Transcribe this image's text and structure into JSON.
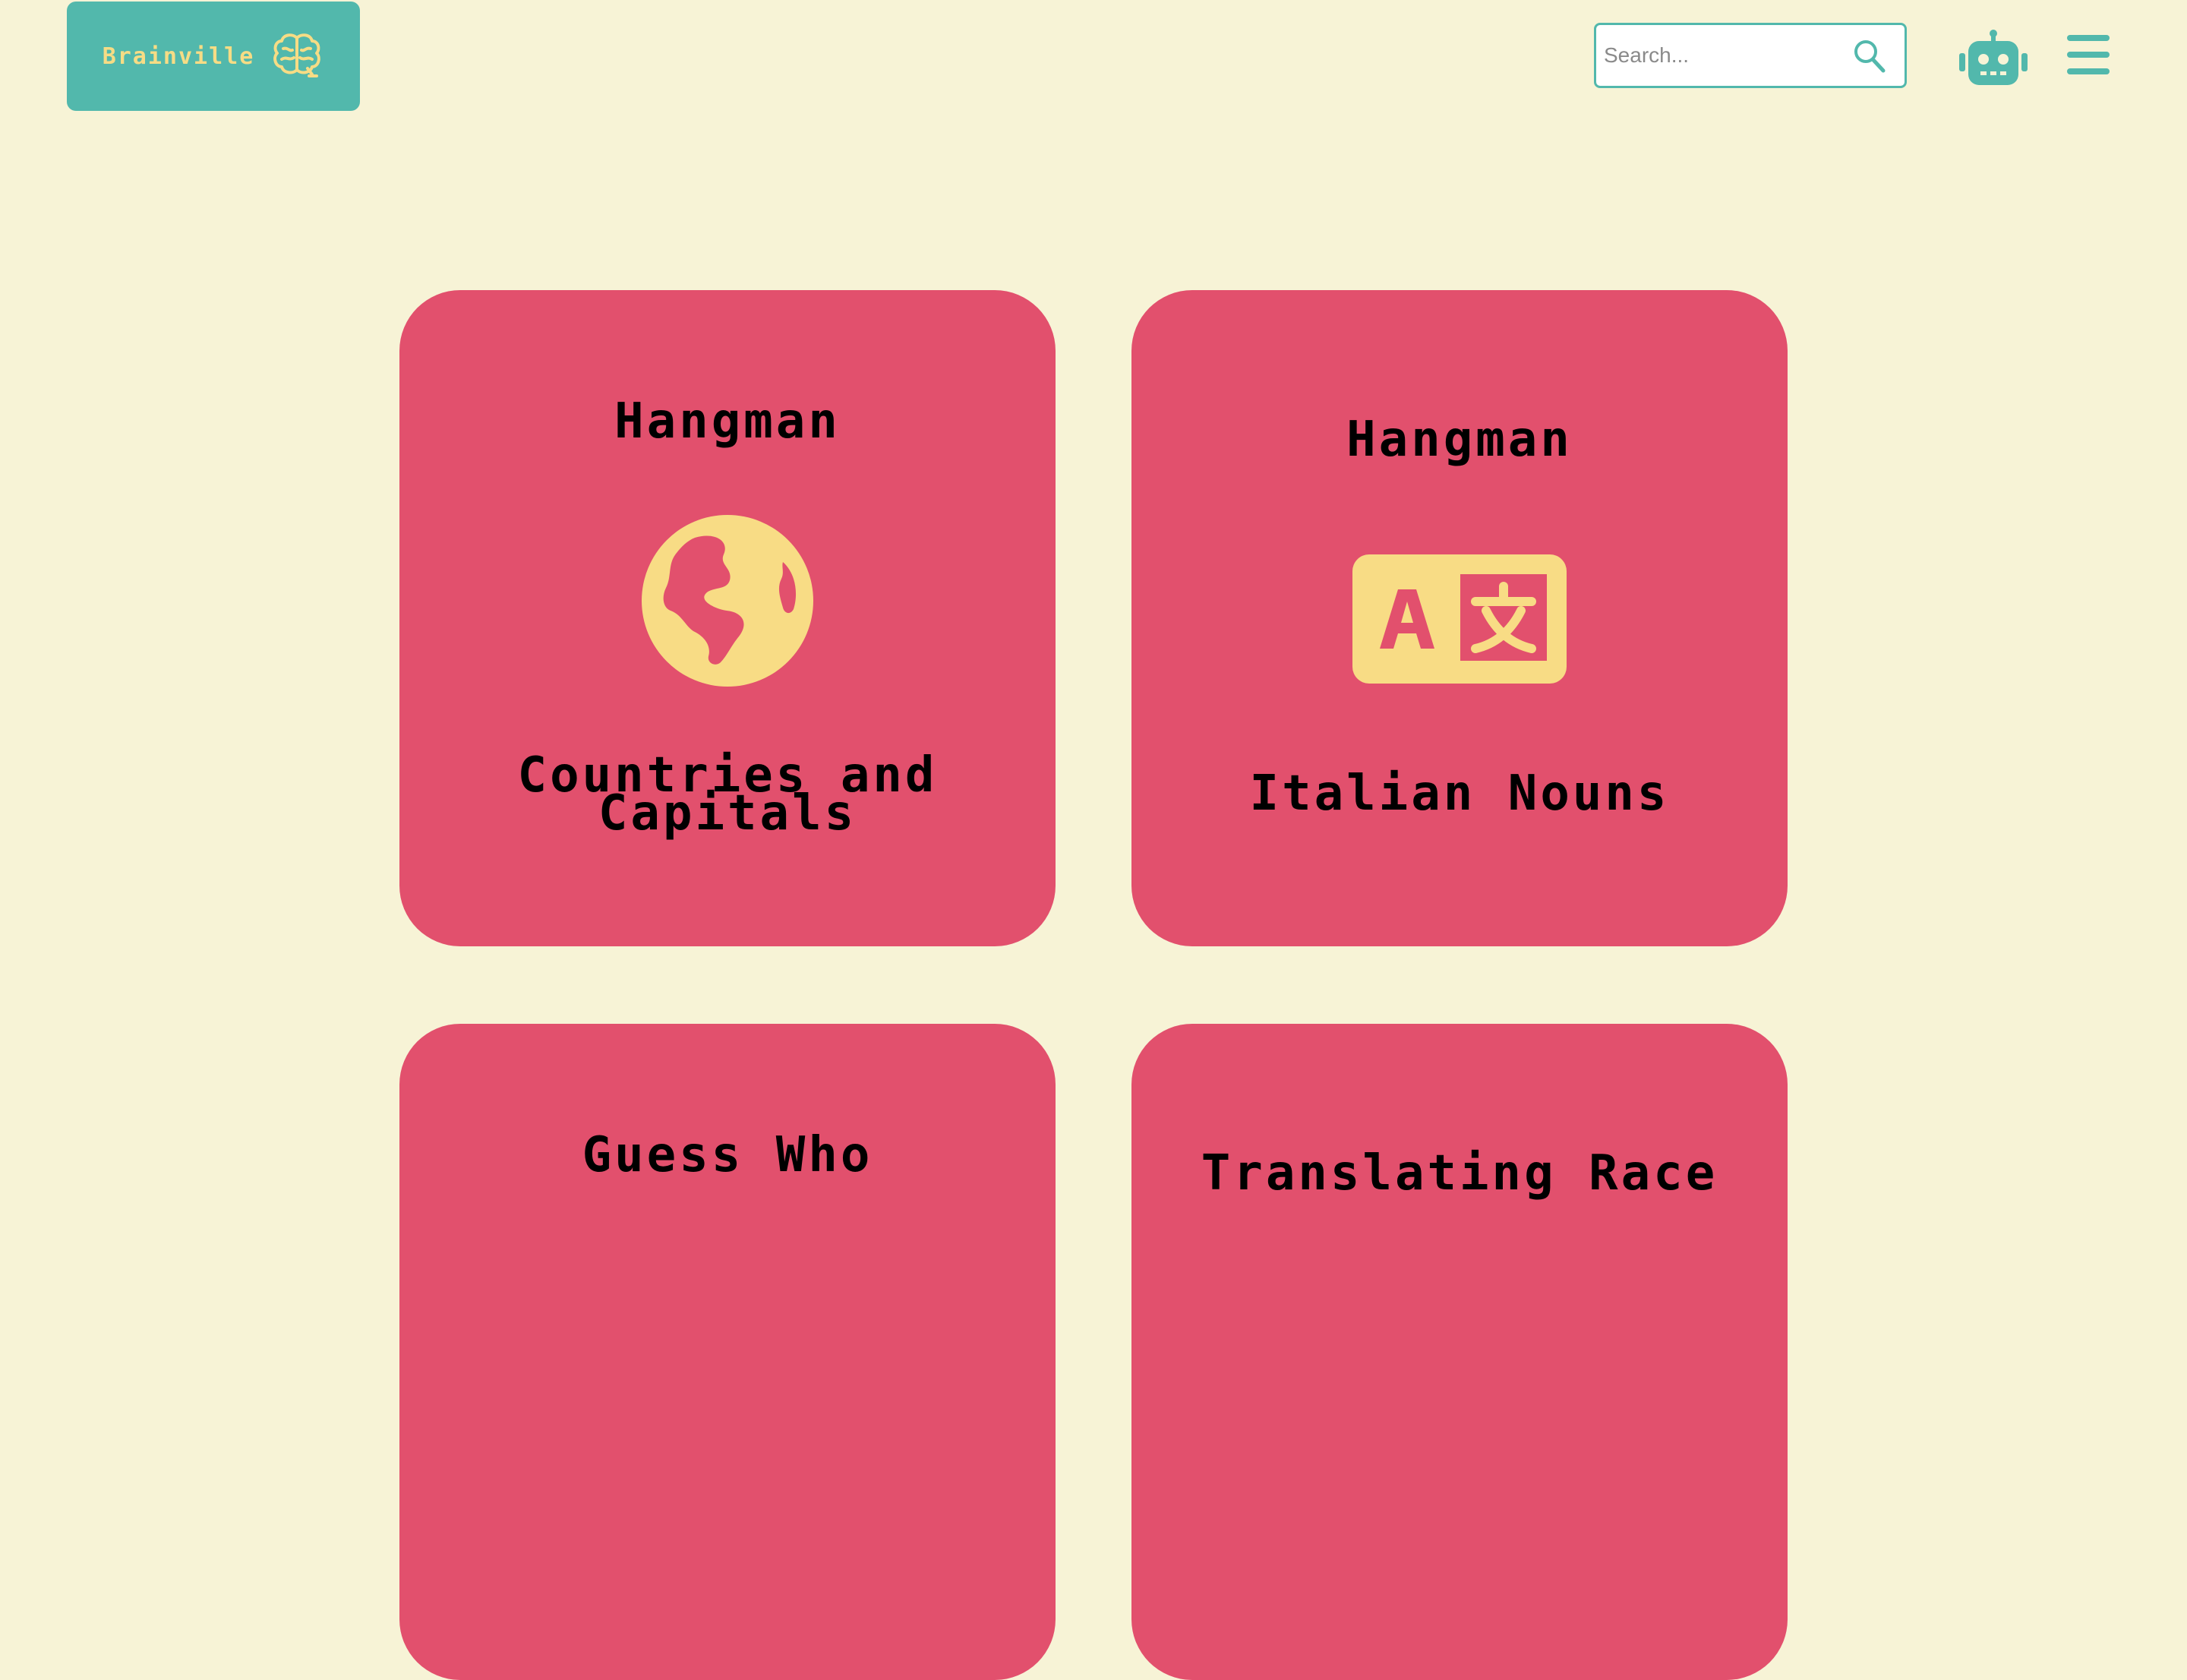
{
  "header": {
    "logo_text": "Brainville",
    "logo_icon": "brain-icon",
    "search_placeholder": "Search...",
    "search_icon": "magnifier-icon",
    "assistant_icon": "robot-icon",
    "menu_icon": "hamburger-menu-icon"
  },
  "colors": {
    "background": "#f7f3d6",
    "brand_teal": "#52b8ac",
    "card_red": "#e2506d",
    "accent_yellow": "#f8dc85"
  },
  "cards": [
    {
      "title": "Hangman",
      "subtitle": "Countries and Capitals",
      "icon": "globe-icon"
    },
    {
      "title": "Hangman",
      "subtitle": "Italian Nouns",
      "icon": "translate-icon"
    },
    {
      "title": "Guess Who",
      "subtitle": "",
      "icon": ""
    },
    {
      "title": "Translating Race",
      "subtitle": "",
      "icon": ""
    }
  ]
}
